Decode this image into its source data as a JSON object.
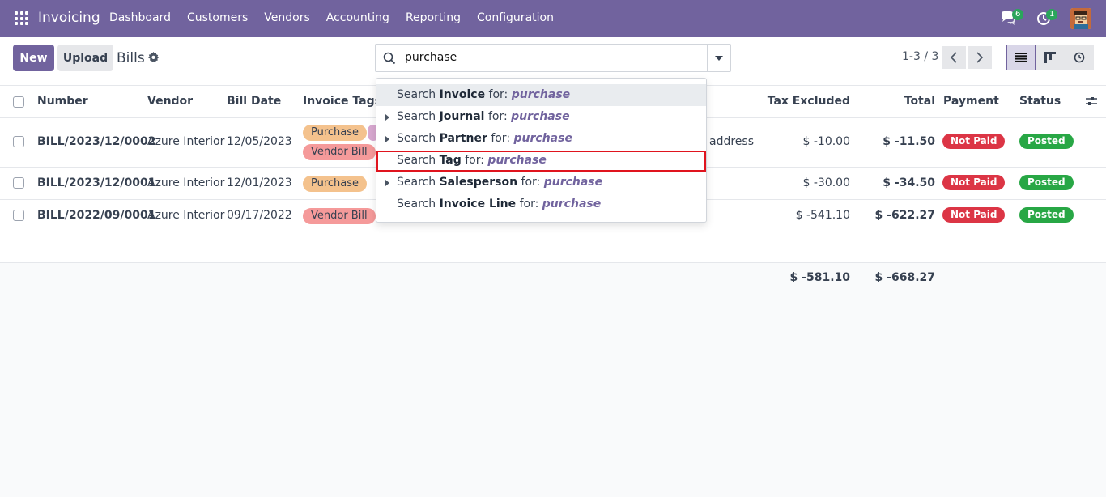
{
  "topbar": {
    "brand": "Invoicing",
    "menu": [
      "Dashboard",
      "Customers",
      "Vendors",
      "Accounting",
      "Reporting",
      "Configuration"
    ],
    "messages_count": "6",
    "activities_count": "1"
  },
  "control": {
    "new_label": "New",
    "upload_label": "Upload",
    "title": "Bills",
    "search_value": "purchase",
    "pager": "1-3 / 3"
  },
  "list": {
    "headers": {
      "number": "Number",
      "vendor": "Vendor",
      "bill_date": "Bill Date",
      "invoice_tags": "Invoice Tags",
      "tax_excluded": "Tax Excluded",
      "total": "Total",
      "payment": "Payment",
      "status": "Status"
    },
    "rows": [
      {
        "number": "BILL/2023/12/0002",
        "vendor": "Azure Interior",
        "date": "12/05/2023",
        "tags": [
          "Purchase",
          "Vendor Bill"
        ],
        "hidden_text": "address",
        "tax_excluded": "$ -10.00",
        "total": "$ -11.50",
        "payment": "Not Paid",
        "status": "Posted"
      },
      {
        "number": "BILL/2023/12/0001",
        "vendor": "Azure Interior",
        "date": "12/01/2023",
        "tags": [
          "Purchase"
        ],
        "tax_excluded": "$ -30.00",
        "total": "$ -34.50",
        "payment": "Not Paid",
        "status": "Posted"
      },
      {
        "number": "BILL/2022/09/0001",
        "vendor": "Azure Interior",
        "date": "09/17/2022",
        "tags": [
          "Vendor Bill"
        ],
        "tax_excluded": "$ -541.10",
        "total": "$ -622.27",
        "payment": "Not Paid",
        "status": "Posted"
      }
    ],
    "totals": {
      "tax_excluded": "$ -581.10",
      "total": "$ -668.27"
    }
  },
  "dropdown": {
    "prefix": "Search",
    "for_label": "for:",
    "query": "purchase",
    "items": [
      {
        "field": "Invoice",
        "expandable": false
      },
      {
        "field": "Journal",
        "expandable": true
      },
      {
        "field": "Partner",
        "expandable": true
      },
      {
        "field": "Tag",
        "expandable": false
      },
      {
        "field": "Salesperson",
        "expandable": true
      },
      {
        "field": "Invoice Line",
        "expandable": false
      }
    ]
  },
  "colors": {
    "brand": "#71639e",
    "highlight_border": "#e0141e",
    "not_paid": "#dc3545",
    "posted": "#28a745"
  }
}
